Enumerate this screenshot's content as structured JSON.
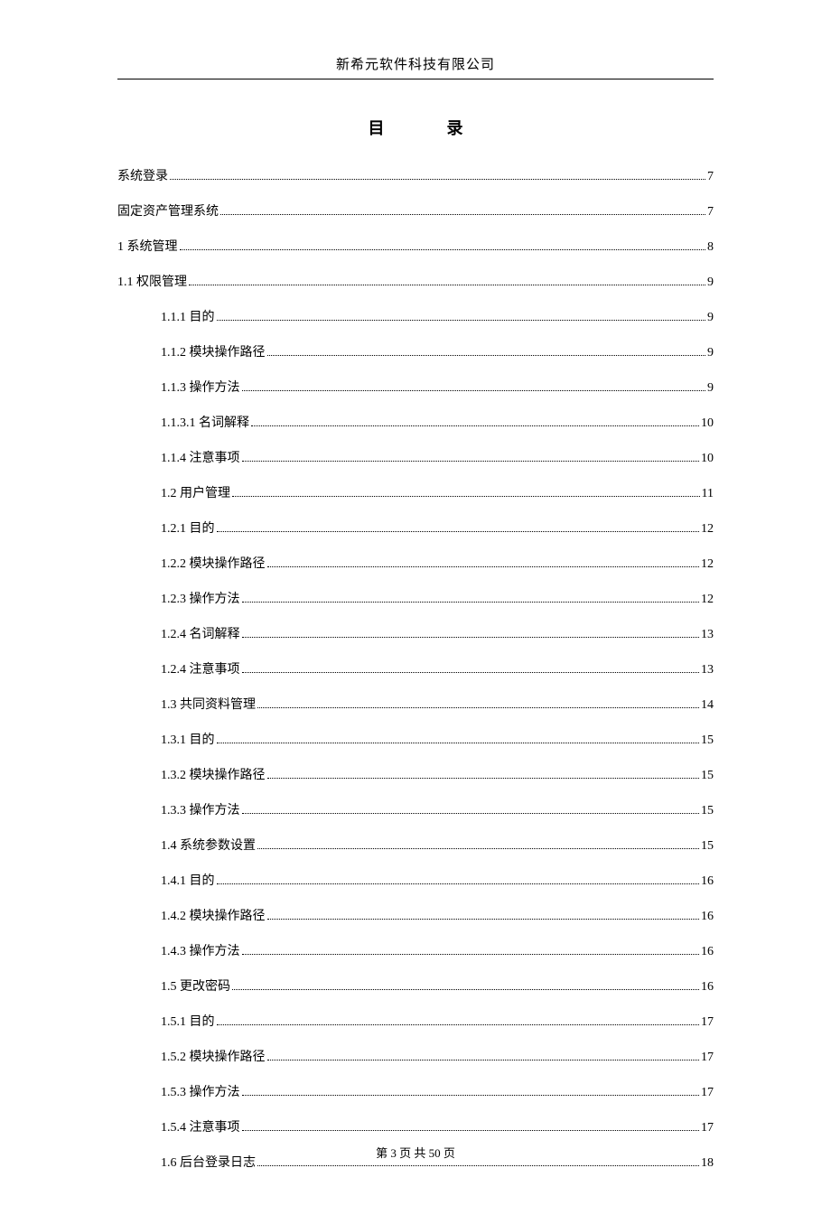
{
  "header": {
    "company": "新希元软件科技有限公司"
  },
  "title": {
    "char1": "目",
    "char2": "录"
  },
  "toc": [
    {
      "level": 0,
      "label": "系统登录",
      "page": "7"
    },
    {
      "level": 0,
      "label": "固定资产管理系统",
      "page": "7"
    },
    {
      "level": 0,
      "label": "1 系统管理",
      "page": "8"
    },
    {
      "level": 0,
      "label": "1.1 权限管理",
      "page": "9"
    },
    {
      "level": 1,
      "label": "1.1.1 目的",
      "page": "9"
    },
    {
      "level": 1,
      "label": "1.1.2 模块操作路径",
      "page": "9"
    },
    {
      "level": 1,
      "label": "1.1.3 操作方法",
      "page": "9"
    },
    {
      "level": 1,
      "label": "1.1.3.1 名词解释",
      "page": "10"
    },
    {
      "level": 1,
      "label": "1.1.4 注意事项",
      "page": "10"
    },
    {
      "level": 1,
      "label": "1.2 用户管理",
      "page": "11"
    },
    {
      "level": 1,
      "label": "1.2.1 目的",
      "page": "12"
    },
    {
      "level": 1,
      "label": "1.2.2 模块操作路径",
      "page": "12"
    },
    {
      "level": 1,
      "label": "1.2.3 操作方法",
      "page": "12"
    },
    {
      "level": 1,
      "label": "1.2.4 名词解释",
      "page": "13"
    },
    {
      "level": 1,
      "label": "1.2.4 注意事项",
      "page": "13"
    },
    {
      "level": 1,
      "label": "1.3 共同资料管理",
      "page": "14"
    },
    {
      "level": 1,
      "label": "1.3.1 目的",
      "page": "15"
    },
    {
      "level": 1,
      "label": "1.3.2 模块操作路径",
      "page": "15"
    },
    {
      "level": 1,
      "label": "1.3.3 操作方法",
      "page": "15"
    },
    {
      "level": 1,
      "label": "1.4 系统参数设置",
      "page": "15"
    },
    {
      "level": 1,
      "label": "1.4.1 目的",
      "page": "16"
    },
    {
      "level": 1,
      "label": "1.4.2 模块操作路径",
      "page": "16"
    },
    {
      "level": 1,
      "label": "1.4.3 操作方法",
      "page": "16"
    },
    {
      "level": 1,
      "label": "1.5 更改密码",
      "page": "16"
    },
    {
      "level": 1,
      "label": "1.5.1 目的",
      "page": "17"
    },
    {
      "level": 1,
      "label": "1.5.2 模块操作路径",
      "page": "17"
    },
    {
      "level": 1,
      "label": "1.5.3 操作方法",
      "page": "17"
    },
    {
      "level": 1,
      "label": "1.5.4 注意事项",
      "page": "17"
    },
    {
      "level": 1,
      "label": "1.6 后台登录日志",
      "page": "18"
    }
  ],
  "footer": {
    "text": "第 3 页 共 50 页"
  }
}
